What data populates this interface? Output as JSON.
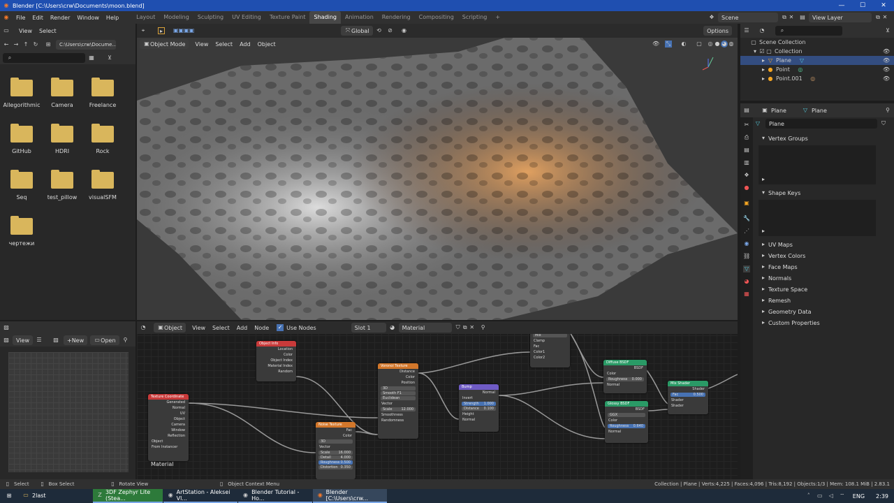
{
  "titlebar": {
    "title": "Blender [C:\\Users\\crw\\Documents\\moon.blend]"
  },
  "menu": [
    "File",
    "Edit",
    "Render",
    "Window",
    "Help"
  ],
  "workspaces": [
    "Layout",
    "Modeling",
    "Sculpting",
    "UV Editing",
    "Texture Paint",
    "Shading",
    "Animation",
    "Rendering",
    "Compositing",
    "Scripting"
  ],
  "active_workspace": "Shading",
  "scene": {
    "label": "Scene",
    "view_layer": "View Layer"
  },
  "filebrowser": {
    "menu": [
      "View",
      "Select"
    ],
    "path": "C:\\Users\\crw\\Docume...",
    "folders": [
      "Allegorithmic",
      "Camera",
      "Freelance",
      "GitHub",
      "HDRI",
      "Rock",
      "Seq",
      "test_pillow",
      "visualSFM",
      "чертежи"
    ]
  },
  "viewport": {
    "mode": "Object Mode",
    "menu": [
      "View",
      "Select",
      "Add",
      "Object"
    ],
    "transform": "Global",
    "options": "Options"
  },
  "image_editor": {
    "view": "View",
    "new": "New",
    "open": "Open"
  },
  "node_editor": {
    "type": "Object",
    "menu": [
      "View",
      "Select",
      "Add",
      "Node"
    ],
    "use_nodes": "Use Nodes",
    "slot": "Slot 1",
    "material": "Material",
    "label": "Material"
  },
  "nodes": {
    "texcoord": {
      "title": "Texture Coordinate",
      "outputs": [
        "Generated",
        "Normal",
        "UV",
        "Object",
        "Camera",
        "Window",
        "Reflection"
      ],
      "object": "Object",
      "from_instancer": "From Instancer"
    },
    "objinfo": {
      "title": "Object Info",
      "outputs": [
        "Location",
        "Color",
        "Object Index",
        "Material Index",
        "Random"
      ]
    },
    "voronoi": {
      "title": "Voronoi Texture",
      "outputs": [
        "Distance",
        "Color",
        "Position"
      ],
      "dim": "3D",
      "feature": "Smooth F1",
      "metric": "Euclidean",
      "vector": "Vector",
      "scale_label": "Scale",
      "scale": "12.000",
      "smooth": "Smoothness",
      "random": "Randomness"
    },
    "noise": {
      "title": "Noise Texture",
      "outputs": [
        "Fac",
        "Color"
      ],
      "dim": "3D",
      "vector": "Vector",
      "scale_label": "Scale",
      "scale": "16.000",
      "detail_label": "Detail",
      "detail": "4.000",
      "rough_label": "Roughness",
      "rough": "0.500",
      "dist_label": "Distortion",
      "dist": "0.350"
    },
    "bump": {
      "title": "Bump",
      "out": "Normal",
      "invert": "Invert",
      "strength_label": "Strength",
      "strength": "1.000",
      "distance_label": "Distance",
      "distance": "0.100",
      "height": "Height",
      "normal": "Normal"
    },
    "mix": {
      "title": "Mix",
      "clamp": "Clamp",
      "fac": "Fac",
      "c1": "Color1",
      "c2": "Color2"
    },
    "diffuse": {
      "title": "Diffuse BSDF",
      "out": "BSDF",
      "color": "Color",
      "rough_label": "Roughness",
      "rough": "0.000",
      "normal": "Normal"
    },
    "glossy": {
      "title": "Glossy BSDF",
      "out": "BSDF",
      "dist": "GGX",
      "color": "Color",
      "rough_label": "Roughness",
      "rough": "0.640",
      "normal": "Normal"
    },
    "mixshader": {
      "title": "Mix Shader",
      "out": "Shader",
      "fac_label": "Fac",
      "fac": "0.500",
      "s1": "Shader",
      "s2": "Shader"
    }
  },
  "outliner": {
    "root": "Scene Collection",
    "items": [
      "Collection",
      "Plane",
      "Point",
      "Point.001"
    ]
  },
  "properties": {
    "object": "Plane",
    "data": "Plane",
    "mesh_name": "Plane",
    "sections": [
      "Vertex Groups",
      "Shape Keys"
    ],
    "collapsed": [
      "UV Maps",
      "Vertex Colors",
      "Face Maps",
      "Normals",
      "Texture Space",
      "Remesh",
      "Geometry Data",
      "Custom Properties"
    ]
  },
  "statusbar": {
    "select": "Select",
    "box": "Box Select",
    "rotate": "Rotate View",
    "context": "Object Context Menu",
    "stats": "Collection | Plane | Verts:4,225 | Faces:4,096 | Tris:8,192 | Objects:1/3 | Mem: 108.1 MiB | 2.83.1"
  },
  "taskbar": {
    "items": [
      "2last",
      "3DF Zephyr Lite (Stea...",
      "ArtStation - Aleksei Vl...",
      "Blender Tutorial - Ho...",
      "Blender [C:\\Users\\crw..."
    ],
    "lang": "ENG",
    "time": "2:39"
  },
  "colors": {
    "accent": "#4772b3",
    "titlebar": "#1f4fb0",
    "texcoord": "#c93a3a",
    "texture": "#d2772b",
    "vector": "#6f5bc5",
    "shader": "#2a9a66"
  }
}
